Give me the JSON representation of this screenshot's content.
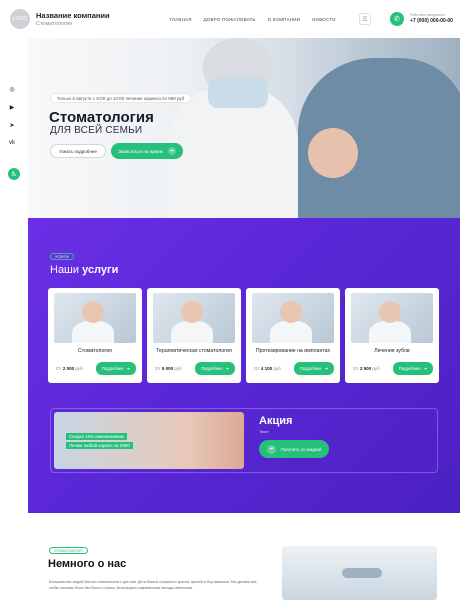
{
  "header": {
    "logo_text": "LOGO",
    "brand_name": "Название компании",
    "brand_sub": "Стоматология",
    "nav": [
      "ГЛАВНАЯ",
      "ДОБРО ПОЖАЛОВАТЬ",
      "О КОМПАНИИ",
      "НОВОСТИ"
    ],
    "phone_label": "Работаем ежедневно",
    "phone": "+7 (000) 000-00-00"
  },
  "hero": {
    "notice": "Только в августе с 9:00 до 14:00 лечение кариеса по 990 руб",
    "title": "Стоматология",
    "subtitle": "ДЛЯ ВСЕЙ СЕМЬИ",
    "btn_more": "Узнать подробнее",
    "btn_book": "Записаться на прием"
  },
  "services": {
    "tag": "УСЛУГИ",
    "title_prefix": "Наши",
    "title_strong": "услуги",
    "cards": [
      {
        "name": "Стоматология",
        "price_prefix": "От",
        "price": "2 000",
        "currency": "руб",
        "btn": "Подробнее"
      },
      {
        "name": "Терапевтическая стоматология",
        "price_prefix": "От",
        "price": "5 000",
        "currency": "руб",
        "btn": "Подробнее"
      },
      {
        "name": "Протезирование на имплантах",
        "price_prefix": "От",
        "price": "4 100",
        "currency": "руб",
        "btn": "Подробнее"
      },
      {
        "name": "Лечение зубов",
        "price_prefix": "От",
        "price": "2 500",
        "currency": "руб",
        "btn": "Подробнее"
      }
    ]
  },
  "promo": {
    "line1": "Скидка 10% именинникам",
    "line2": "Лечим любой кариес за 2990",
    "title": "Акция",
    "sub": "Текст",
    "btn": "Получить со скидкой"
  },
  "about": {
    "tag": "СТОМАТОЛОГИЯ",
    "title": "Немного о нас",
    "text": "Большинство людей боятся стоматологов с детства. Дети боятся страшного кресла, врачей и бор машинки. Мы делаем всё, чтобы лечение было без боли и страха. Используем современные методы анестезии."
  },
  "colors": {
    "accent": "#27c07a",
    "purple": "#5a27d6"
  }
}
